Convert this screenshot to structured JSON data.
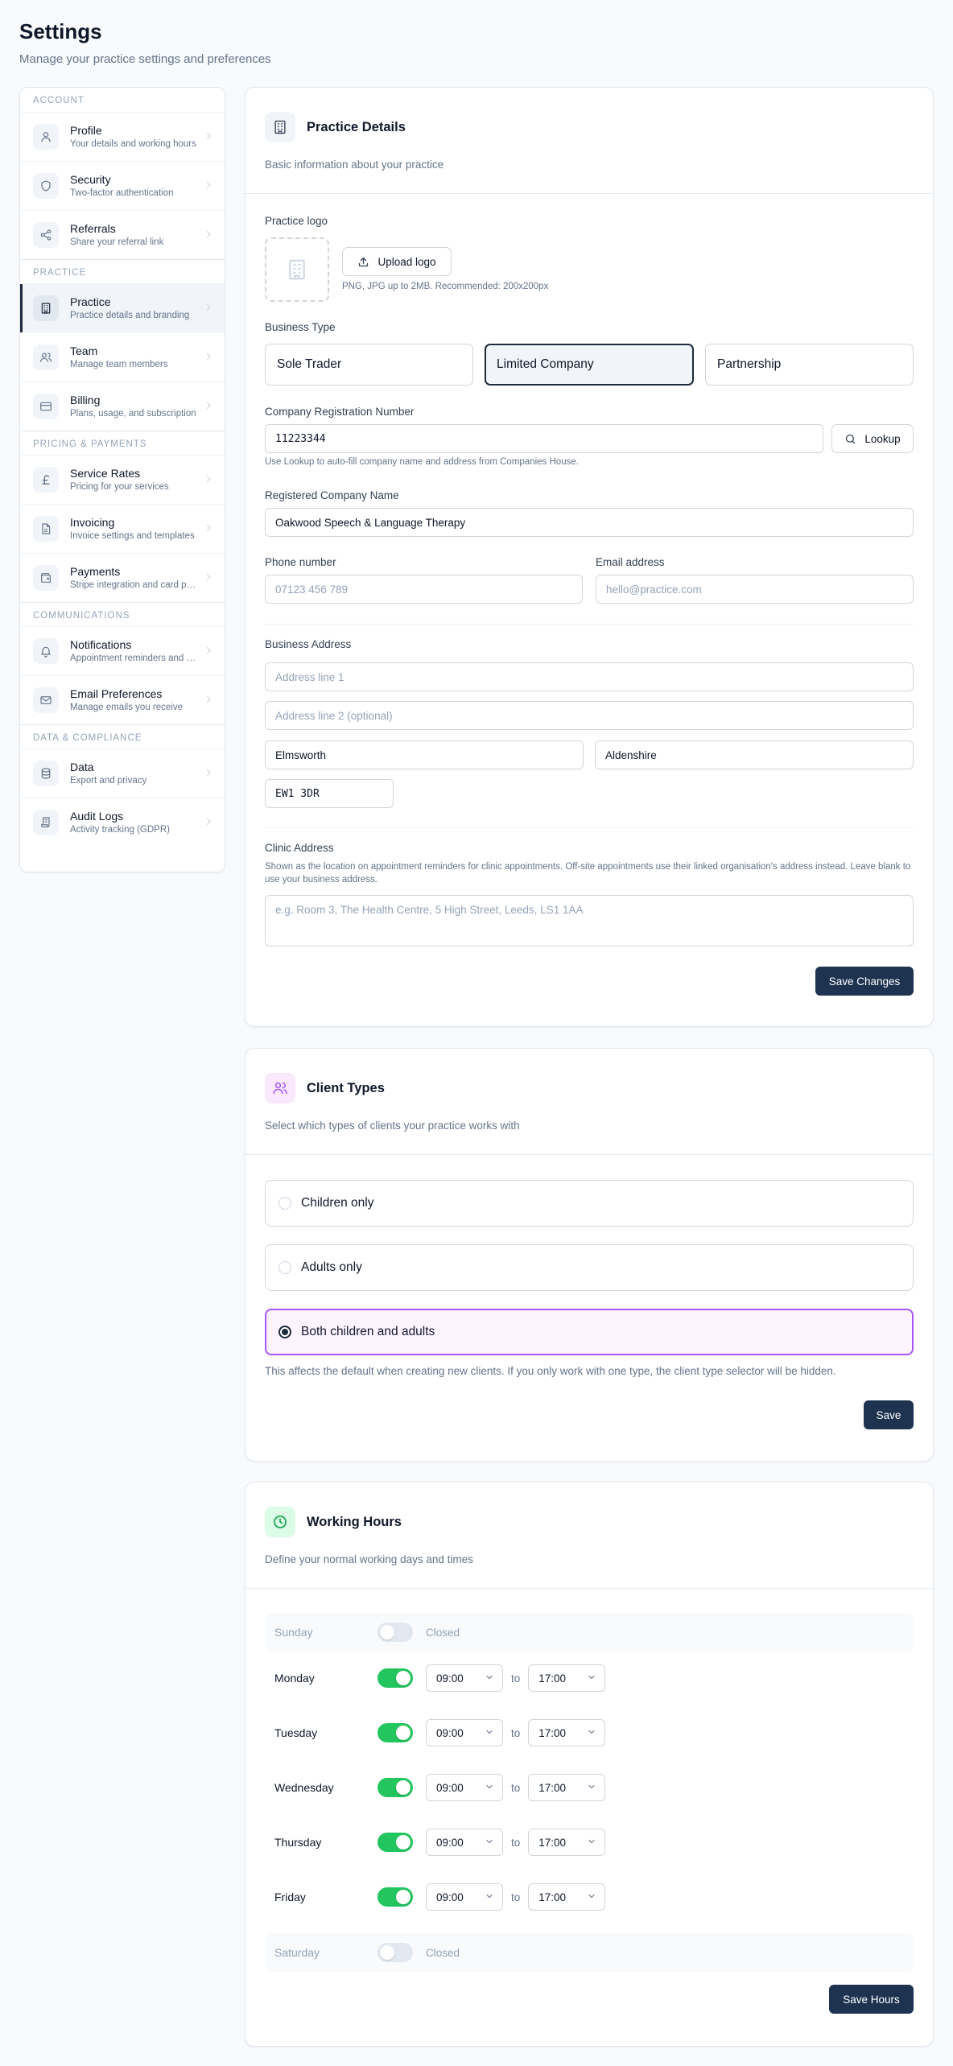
{
  "page": {
    "title": "Settings",
    "subtitle": "Manage your practice settings and preferences"
  },
  "sidebar": {
    "groups": [
      {
        "label": "Account",
        "items": [
          {
            "title": "Profile",
            "desc": "Your details and working hours",
            "icon": "user-icon"
          },
          {
            "title": "Security",
            "desc": "Two-factor authentication",
            "icon": "shield-icon"
          },
          {
            "title": "Referrals",
            "desc": "Share your referral link",
            "icon": "share-icon"
          }
        ]
      },
      {
        "label": "Practice",
        "items": [
          {
            "title": "Practice",
            "desc": "Practice details and branding",
            "icon": "building-icon"
          },
          {
            "title": "Team",
            "desc": "Manage team members",
            "icon": "users-icon"
          },
          {
            "title": "Billing",
            "desc": "Plans, usage, and subscription",
            "icon": "credit-card-icon"
          }
        ]
      },
      {
        "label": "Pricing & Payments",
        "items": [
          {
            "title": "Service Rates",
            "desc": "Pricing for your services",
            "icon": "pound-icon"
          },
          {
            "title": "Invoicing",
            "desc": "Invoice settings and templates",
            "icon": "document-icon"
          },
          {
            "title": "Payments",
            "desc": "Stripe integration and card payments",
            "icon": "wallet-icon"
          }
        ]
      },
      {
        "label": "Communications",
        "items": [
          {
            "title": "Notifications",
            "desc": "Appointment reminders and alerts",
            "icon": "bell-icon"
          },
          {
            "title": "Email Preferences",
            "desc": "Manage emails you receive",
            "icon": "mail-icon"
          }
        ]
      },
      {
        "label": "Data & Compliance",
        "items": [
          {
            "title": "Data",
            "desc": "Export and privacy",
            "icon": "database-icon"
          },
          {
            "title": "Audit Logs",
            "desc": "Activity tracking (GDPR)",
            "icon": "scroll-icon"
          }
        ]
      }
    ]
  },
  "practice": {
    "title": "Practice Details",
    "desc": "Basic information about your practice",
    "logo_label": "Practice logo",
    "upload_label": "Upload logo",
    "upload_hint": "PNG, JPG up to 2MB. Recommended: 200x200px",
    "business_type_label": "Business Type",
    "business_types": [
      "Sole Trader",
      "Limited Company",
      "Partnership"
    ],
    "selected_business_type": "Limited Company",
    "crn_label": "Company Registration Number",
    "crn_value": "11223344",
    "lookup_label": "Lookup",
    "crn_hint": "Use Lookup to auto-fill company name and address from Companies House.",
    "company_name_label": "Registered Company Name",
    "company_name_value": "Oakwood Speech & Language Therapy",
    "phone_label": "Phone number",
    "phone_placeholder": "07123 456 789",
    "email_label": "Email address",
    "email_placeholder": "hello@practice.com",
    "address_label": "Business Address",
    "address_line1_placeholder": "Address line 1",
    "address_line2_placeholder": "Address line 2 (optional)",
    "city_value": "Elmsworth",
    "county_value": "Aldenshire",
    "postcode_value": "EW1 3DR",
    "clinic_label": "Clinic Address",
    "clinic_hint": "Shown as the location on appointment reminders for clinic appointments. Off-site appointments use their linked organisation's address instead. Leave blank to use your business address.",
    "clinic_placeholder": "e.g. Room 3, The Health Centre, 5 High Street, Leeds, LS1 1AA",
    "save_label": "Save Changes"
  },
  "client_types": {
    "title": "Client Types",
    "desc": "Select which types of clients your practice works with",
    "options": [
      "Children only",
      "Adults only",
      "Both children and adults"
    ],
    "selected": "Both children and adults",
    "note": "This affects the default when creating new clients. If you only work with one type, the client type selector will be hidden.",
    "save_label": "Save"
  },
  "working_hours": {
    "title": "Working Hours",
    "desc": "Define your normal working days and times",
    "to_label": "to",
    "closed_label": "Closed",
    "days": [
      {
        "name": "Sunday",
        "enabled": false,
        "start": "",
        "end": ""
      },
      {
        "name": "Monday",
        "enabled": true,
        "start": "09:00",
        "end": "17:00"
      },
      {
        "name": "Tuesday",
        "enabled": true,
        "start": "09:00",
        "end": "17:00"
      },
      {
        "name": "Wednesday",
        "enabled": true,
        "start": "09:00",
        "end": "17:00"
      },
      {
        "name": "Thursday",
        "enabled": true,
        "start": "09:00",
        "end": "17:00"
      },
      {
        "name": "Friday",
        "enabled": true,
        "start": "09:00",
        "end": "17:00"
      },
      {
        "name": "Saturday",
        "enabled": false,
        "start": "",
        "end": ""
      }
    ],
    "save_label": "Save Hours"
  },
  "colors": {
    "primary_button": "#1e3350",
    "toggle_on": "#22c55e",
    "client_types_accent": "#a855f7",
    "working_hours_accent": "#16a34a"
  }
}
